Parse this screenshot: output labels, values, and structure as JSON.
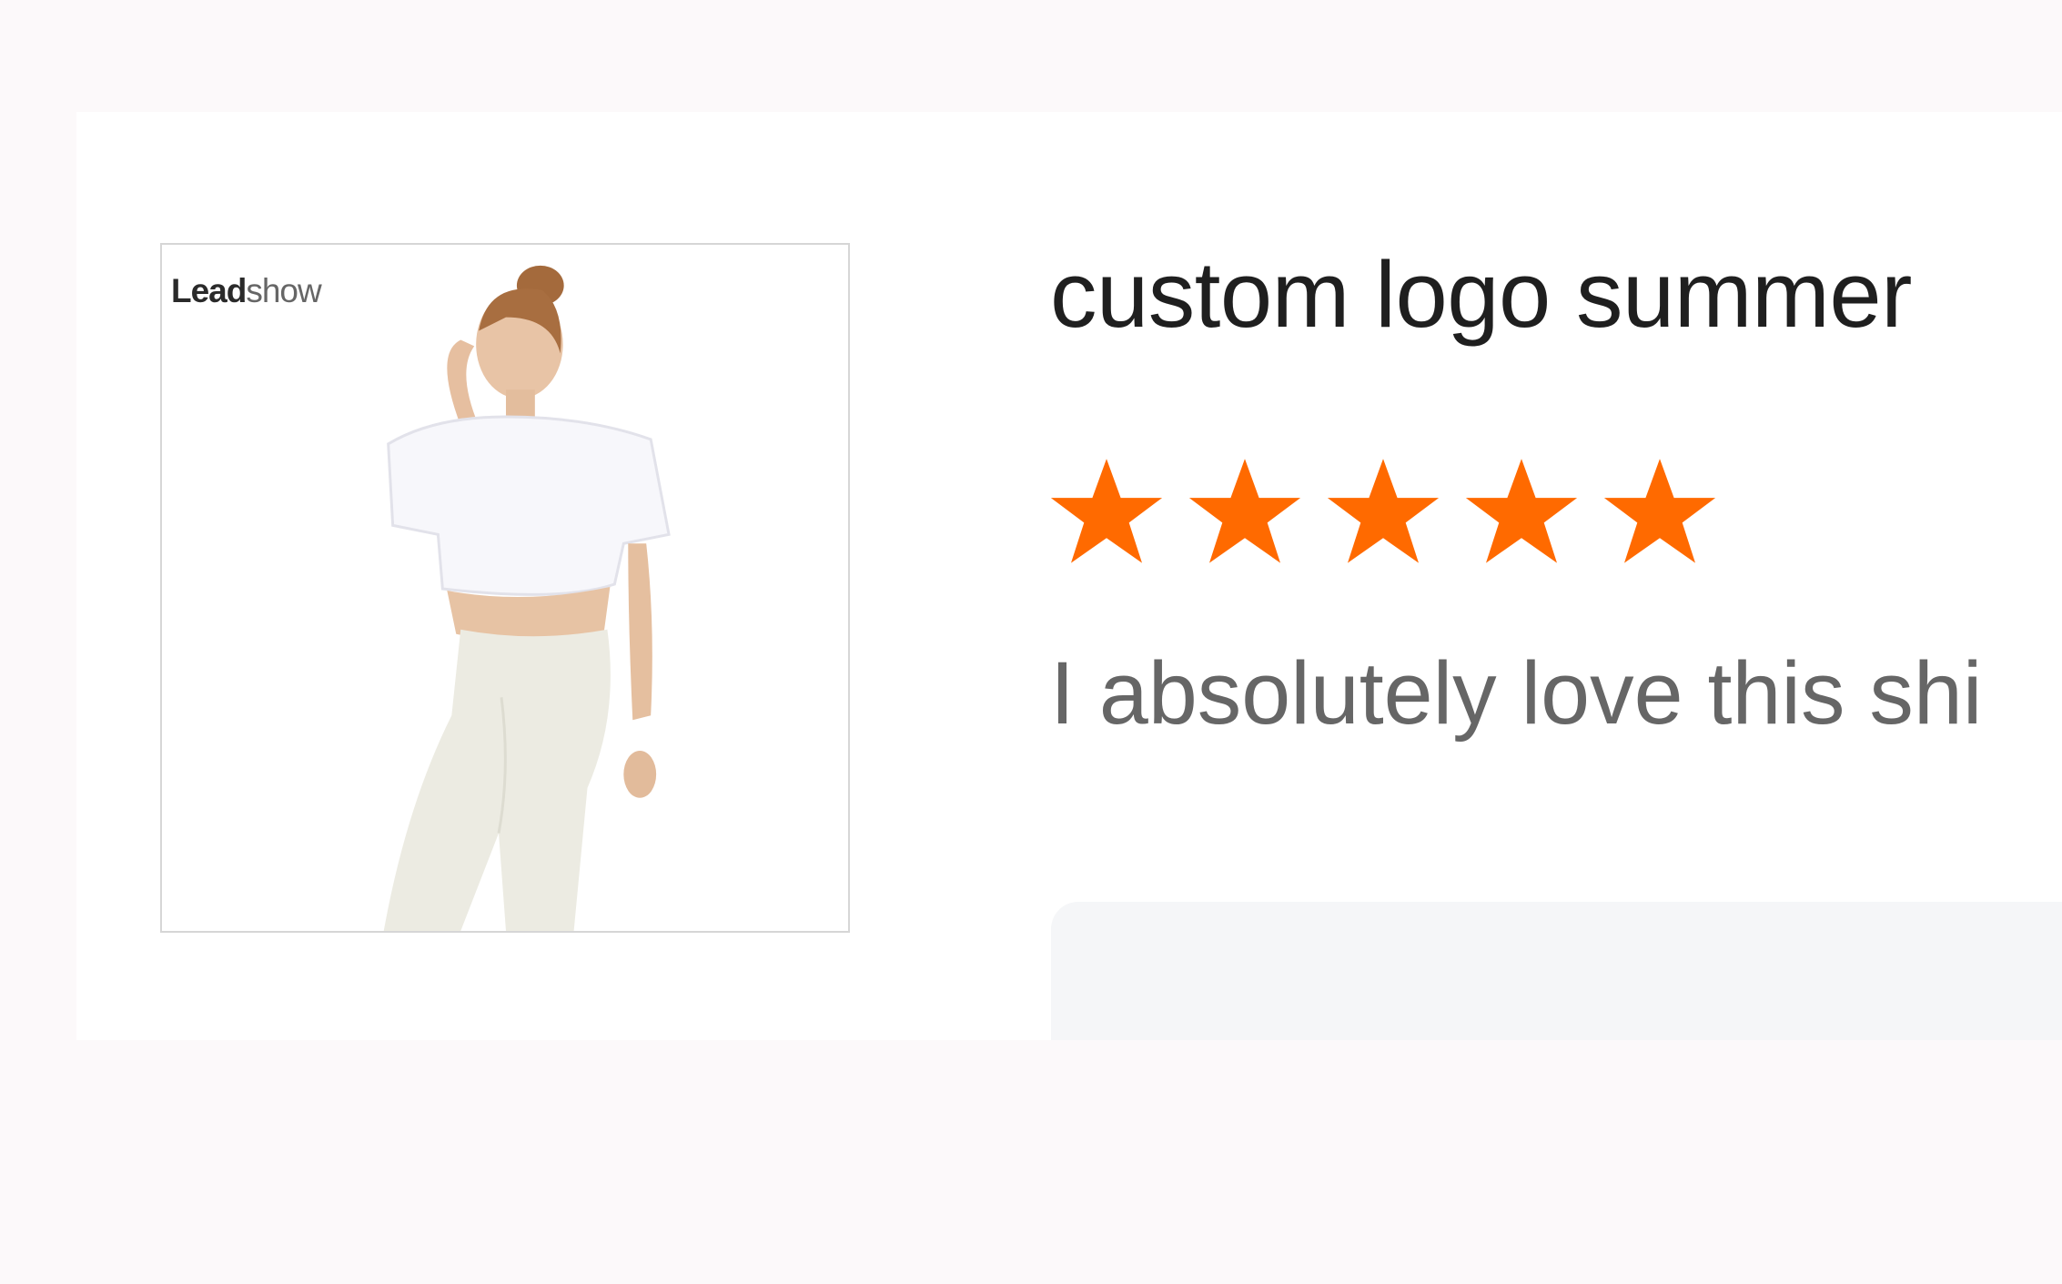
{
  "product": {
    "image_alt": "Woman wearing white crop t-shirt and light leggings",
    "brand_logo_text_bold": "Lead",
    "brand_logo_text_light": "show",
    "title": "custom logo summer"
  },
  "rating": {
    "stars": 5,
    "max": 5,
    "color": "#ff6a00",
    "icon": "star-icon"
  },
  "review": {
    "text": "I absolutely love this shi"
  }
}
